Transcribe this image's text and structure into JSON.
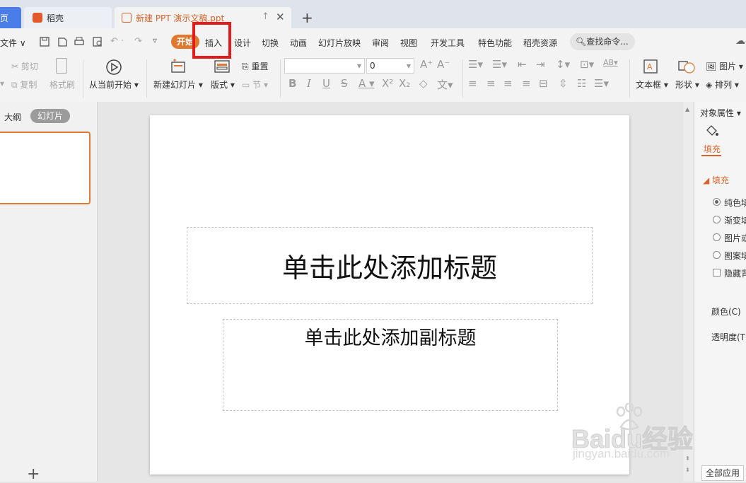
{
  "tabs": {
    "home": "页",
    "daoke": "稻壳",
    "document": "新建 PPT 演示文稿.ppt"
  },
  "menu": {
    "file": "文件",
    "start": "开始",
    "items": [
      "插入",
      "设计",
      "切换",
      "动画",
      "幻灯片放映",
      "审阅",
      "视图",
      "开发工具",
      "特色功能",
      "稻壳资源"
    ],
    "search": "查找命令..."
  },
  "ribbon": {
    "cut": "剪切",
    "copy": "复制",
    "format_painter": "格式刷",
    "from_current": "从当前开始",
    "new_slide": "新建幻灯片",
    "layout": "版式",
    "reset": "重置",
    "section": "节",
    "font_size": "0",
    "text_box": "文本框",
    "shape": "形状",
    "picture": "图片",
    "arrange": "排列"
  },
  "left_panel": {
    "outline_tab": "大纲",
    "slides_tab": "幻灯片",
    "add": "+"
  },
  "slide": {
    "title_placeholder": "单击此处添加标题",
    "subtitle_placeholder": "单击此处添加副标题"
  },
  "right_panel": {
    "header": "对象属性",
    "fill_tab": "填充",
    "fill_section": "填充",
    "options": [
      "纯色填",
      "渐变填",
      "图片或",
      "图案填"
    ],
    "hide_bg": "隐藏背",
    "color_label": "颜色(C)",
    "transparency_label": "透明度(T)",
    "apply_all": "全部应用"
  },
  "watermark": {
    "brand": "Baidu经验",
    "url": "jingyan.baidu.com"
  },
  "colors": {
    "accent": "#e0782f",
    "highlight": "#e31b1b",
    "home_tab": "#4a7de8"
  }
}
